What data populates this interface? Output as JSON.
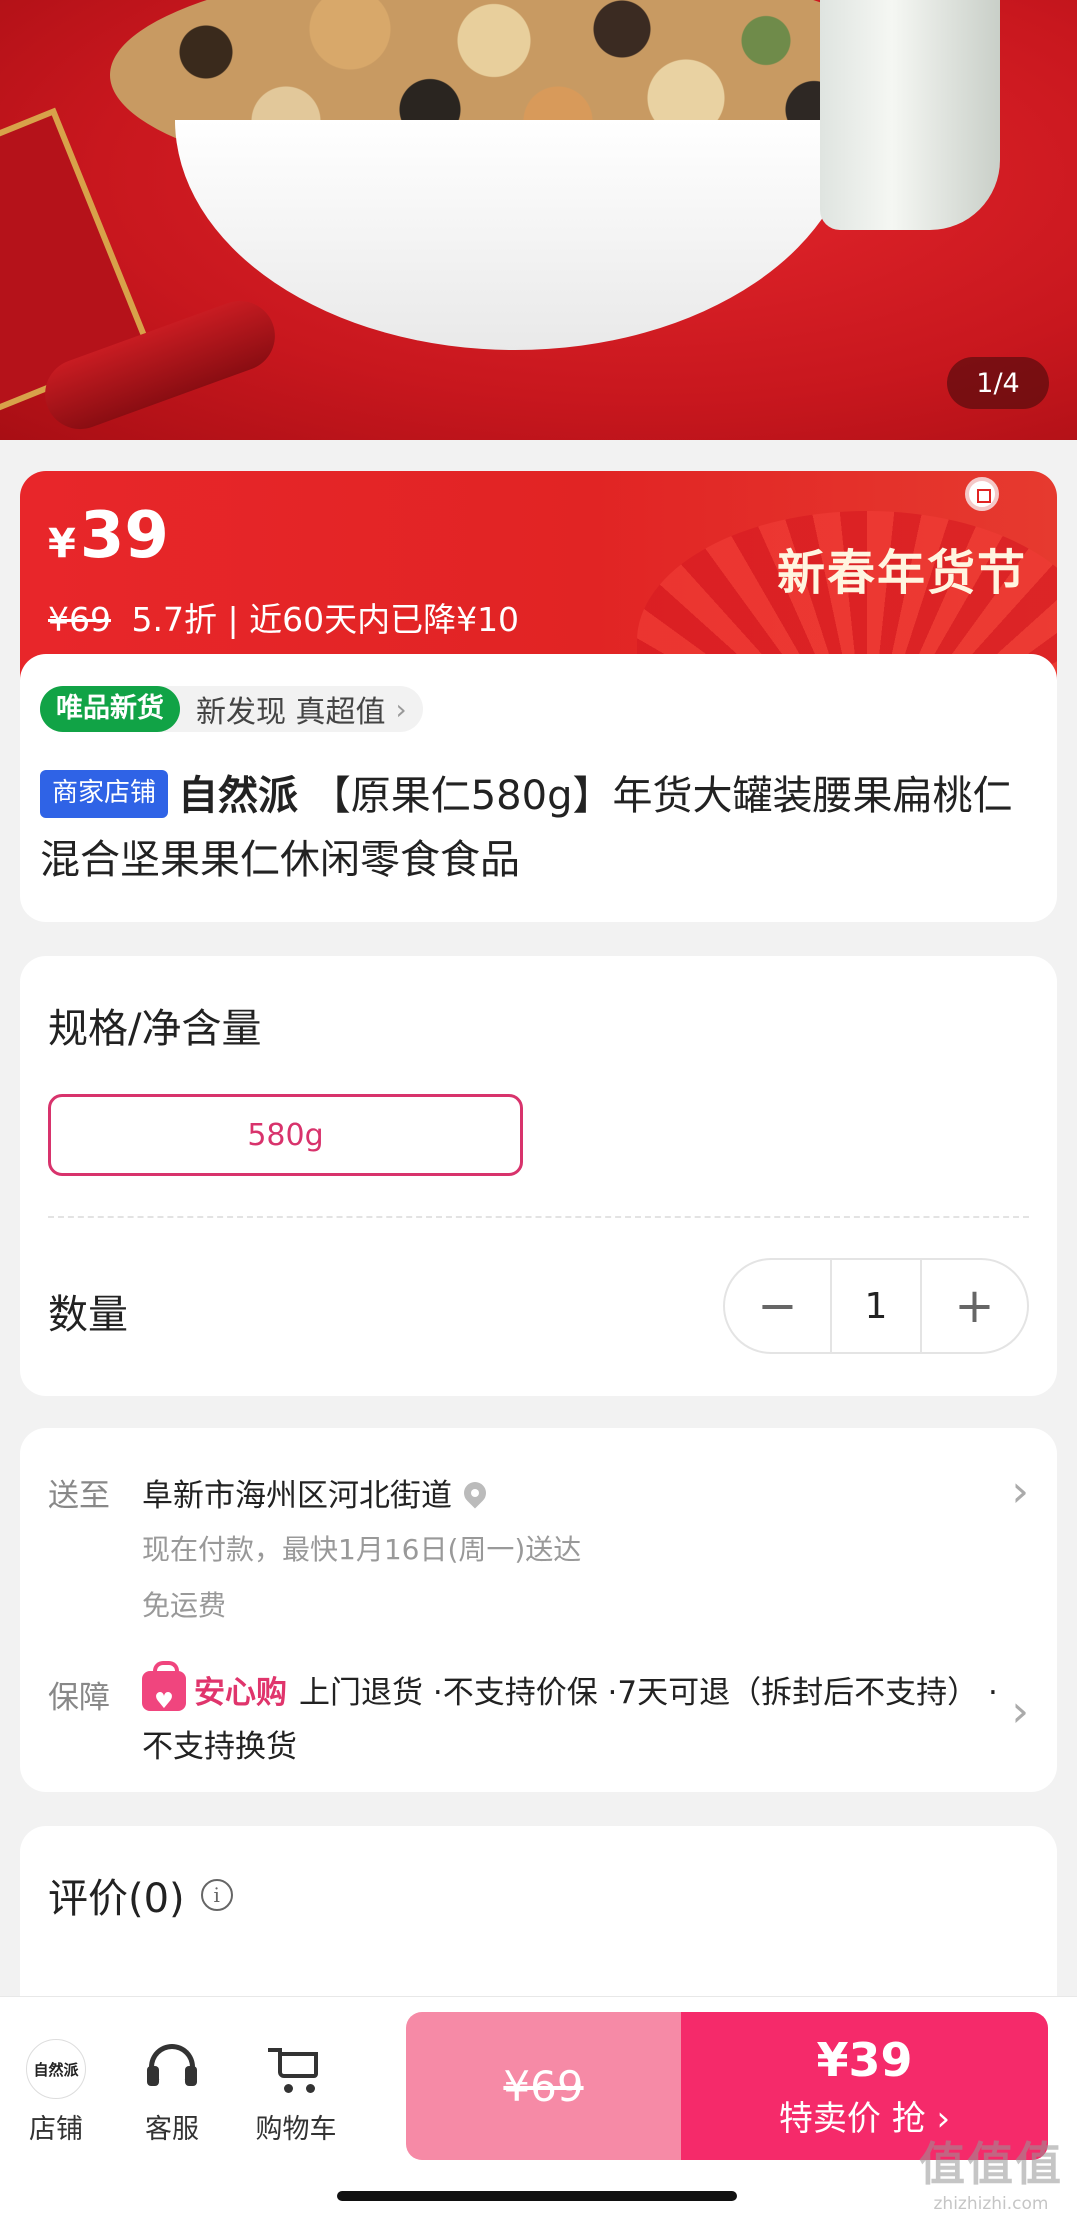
{
  "hero": {
    "image_counter": "1/4"
  },
  "price_banner": {
    "currency": "¥",
    "price": "39",
    "original_price": "¥69",
    "discount_info": "5.7折 | 近60天内已降¥10",
    "festival_label": "新春年货节"
  },
  "product": {
    "new_tag": "唯品新货",
    "new_tag_text": "新发现 真超值",
    "shop_tag": "商家店铺",
    "brand": "自然派",
    "title": " 【原果仁580g】年货大罐装腰果扁桃仁混合坚果果仁休闲零食食品"
  },
  "spec": {
    "title": "规格/净含量",
    "selected_option": "580g",
    "quantity_label": "数量",
    "quantity": "1",
    "minus": "−",
    "plus": "+"
  },
  "delivery": {
    "ship_label": "送至",
    "address": "阜新市海州区河北街道",
    "eta": "现在付款，最快1月16日(周一)送达",
    "shipping_fee": "免运费",
    "guarantee_label": "保障",
    "guarantee_brand": "安心购",
    "guarantee_text": "上门退货 ·不支持价保 ·7天可退（拆封后不支持） ·不支持换货"
  },
  "review": {
    "title": "评价(0)"
  },
  "bottom_bar": {
    "shop_logo_text": "自然派",
    "shop_label": "店铺",
    "service_label": "客服",
    "cart_label": "购物车",
    "orig_price": "¥69",
    "buy_price": "¥39",
    "buy_label": "特卖价 抢 ›"
  },
  "watermark": {
    "text": "值值值",
    "domain": "zhizhizhi.com"
  },
  "colors": {
    "accent": "#f52a6a",
    "banner_red": "#e12424",
    "green_tag": "#11a346",
    "shop_blue": "#2f63e6"
  }
}
